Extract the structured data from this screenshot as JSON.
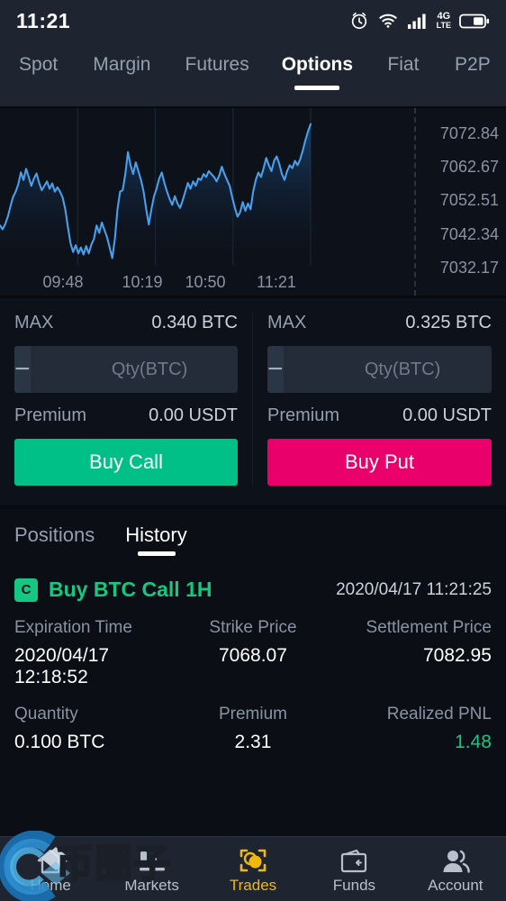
{
  "statusbar": {
    "time": "11:21",
    "icons": [
      "alarm-icon",
      "wifi-icon",
      "signal-icon",
      "4g-lte-icon",
      "battery-icon"
    ],
    "network_label_top": "4G",
    "network_label_bottom": "LTE"
  },
  "topnav": {
    "items": [
      {
        "label": "Spot",
        "active": false
      },
      {
        "label": "Margin",
        "active": false
      },
      {
        "label": "Futures",
        "active": false
      },
      {
        "label": "Options",
        "active": true
      },
      {
        "label": "Fiat",
        "active": false
      },
      {
        "label": "P2P",
        "active": false
      }
    ]
  },
  "chart_data": {
    "type": "line",
    "title": "",
    "xlabel": "",
    "ylabel": "",
    "grid": true,
    "legend": "none",
    "line_color": "#4a9eea",
    "fill_color": "#10355c",
    "ytick_labels": [
      "7072.84",
      "7062.67",
      "7052.51",
      "7042.34",
      "7032.17"
    ],
    "ylim": [
      7027.0,
      7078.0
    ],
    "xtick_labels": [
      "09:48",
      "10:19",
      "10:50",
      "11:21"
    ],
    "x": [
      0,
      1,
      2,
      3,
      4,
      5,
      6,
      7,
      8,
      9,
      10,
      11,
      12,
      13,
      14,
      15,
      16,
      17,
      18,
      19,
      20,
      21,
      22,
      23,
      24,
      25,
      26,
      27,
      28,
      29,
      30,
      31,
      32,
      33,
      34,
      35,
      36,
      37,
      38,
      39,
      40,
      41,
      42,
      43,
      44,
      45,
      46,
      47,
      48,
      49,
      50,
      51,
      52,
      53,
      54,
      55,
      56,
      57,
      58,
      59,
      60,
      61,
      62,
      63,
      64,
      65,
      66,
      67,
      68,
      69,
      70,
      71,
      72,
      73,
      74,
      75,
      76,
      77,
      78,
      79,
      80,
      81,
      82,
      83,
      84,
      85,
      86,
      87,
      88,
      89,
      90,
      91,
      92,
      93,
      94,
      95,
      96,
      97,
      98,
      99,
      100,
      101,
      102,
      103,
      104,
      105,
      106,
      107,
      108,
      109,
      110,
      111,
      112,
      113,
      114,
      115,
      116,
      117,
      118,
      119
    ],
    "values": [
      7040.5,
      7039.2,
      7041.0,
      7043.5,
      7047.0,
      7050.2,
      7052.0,
      7054.5,
      7058.6,
      7056.0,
      7059.8,
      7057.0,
      7054.0,
      7056.5,
      7058.2,
      7055.0,
      7052.5,
      7054.0,
      7055.5,
      7053.0,
      7054.8,
      7052.0,
      7053.5,
      7052.0,
      7050.0,
      7046.0,
      7040.0,
      7034.5,
      7031.5,
      7033.8,
      7031.0,
      7033.0,
      7030.6,
      7033.5,
      7031.0,
      7034.0,
      7036.0,
      7040.5,
      7038.0,
      7041.5,
      7039.0,
      7036.5,
      7033.0,
      7029.4,
      7036.0,
      7046.0,
      7052.0,
      7052.5,
      7058.0,
      7065.5,
      7061.0,
      7058.0,
      7062.0,
      7059.0,
      7056.0,
      7052.0,
      7046.0,
      7040.8,
      7046.0,
      7050.5,
      7053.0,
      7056.5,
      7058.5,
      7055.0,
      7052.0,
      7049.5,
      7047.5,
      7050.5,
      7048.0,
      7046.5,
      7049.0,
      7052.0,
      7055.0,
      7053.0,
      7055.5,
      7054.0,
      7056.5,
      7056.0,
      7058.0,
      7057.0,
      7059.0,
      7058.0,
      7057.0,
      7055.5,
      7057.5,
      7060.5,
      7058.0,
      7056.0,
      7054.0,
      7050.0,
      7046.5,
      7043.5,
      7045.0,
      7048.5,
      7045.5,
      7048.0,
      7046.0,
      7052.0,
      7056.0,
      7058.5,
      7057.0,
      7060.0,
      7063.5,
      7061.0,
      7059.0,
      7062.5,
      7064.0,
      7061.5,
      7058.0,
      7056.0,
      7059.0,
      7061.0,
      7060.0,
      7062.5,
      7061.0,
      7063.0,
      7066.0,
      7069.5,
      7072.5,
      7075.0
    ]
  },
  "trade": {
    "call": {
      "max_label": "MAX",
      "max_value": "0.340 BTC",
      "minus_label": "−",
      "plus_label": "+",
      "qty_value": "",
      "qty_placeholder": "Qty(BTC)",
      "premium_label": "Premium",
      "premium_value": "0.00 USDT",
      "button_label": "Buy Call",
      "button_color": "#00c087"
    },
    "put": {
      "max_label": "MAX",
      "max_value": "0.325 BTC",
      "minus_label": "−",
      "plus_label": "+",
      "qty_value": "",
      "qty_placeholder": "Qty(BTC)",
      "premium_label": "Premium",
      "premium_value": "0.00 USDT",
      "button_label": "Buy Put",
      "button_color": "#e9006b"
    }
  },
  "history": {
    "tabs": [
      {
        "label": "Positions",
        "active": false
      },
      {
        "label": "History",
        "active": true
      }
    ],
    "entry": {
      "badge": "C",
      "badge_color": "#16c784",
      "title": "Buy BTC Call 1H",
      "title_color": "#16c784",
      "timestamp": "2020/04/17 11:21:25",
      "fields": [
        {
          "label": "Expiration Time",
          "value": "2020/04/17 12:18:52",
          "color": "#ffffff"
        },
        {
          "label": "Strike Price",
          "value": "7068.07",
          "color": "#ffffff"
        },
        {
          "label": "Settlement Price",
          "value": "7082.95",
          "color": "#ffffff"
        },
        {
          "label": "Quantity",
          "value": "0.100 BTC",
          "color": "#ffffff"
        },
        {
          "label": "Premium",
          "value": "2.31",
          "color": "#ffffff"
        },
        {
          "label": "Realized PNL",
          "value": "1.48",
          "color": "#16c784"
        }
      ]
    }
  },
  "bottomnav": {
    "items": [
      {
        "label": "Home",
        "icon": "home-icon",
        "active": false
      },
      {
        "label": "Markets",
        "icon": "markets-icon",
        "active": false
      },
      {
        "label": "Trades",
        "icon": "trades-icon",
        "active": true
      },
      {
        "label": "Funds",
        "icon": "funds-icon",
        "active": false
      },
      {
        "label": "Account",
        "icon": "account-icon",
        "active": false
      }
    ]
  },
  "watermark": {
    "text": "币圈子"
  }
}
